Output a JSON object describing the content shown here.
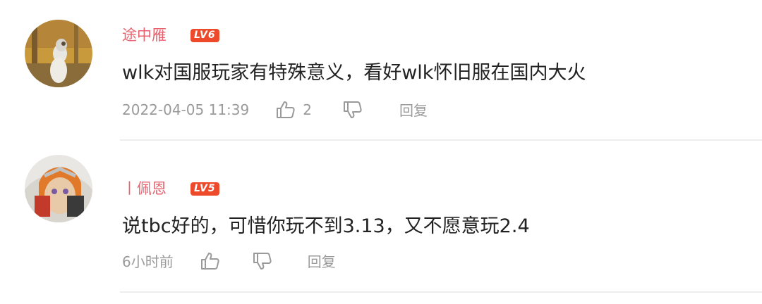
{
  "comments": [
    {
      "username": "途中雁",
      "level": "LV6",
      "content": "wlk对国服玩家有特殊意义，看好wlk怀旧服在国内大火",
      "time": "2022-04-05 11:39",
      "likes": "2",
      "reply_label": "回复",
      "avatar_icon": "dog-photo-avatar"
    },
    {
      "username": "丨佩恩",
      "level": "LV5",
      "content": "说tbc好的，可惜你玩不到3.13，又不愿意玩2.4",
      "time": "6小时前",
      "likes": "",
      "reply_label": "回复",
      "avatar_icon": "anime-character-avatar"
    }
  ],
  "colors": {
    "username": "#e8636f",
    "level_badge": "#ec4a2b",
    "meta": "#9a9a9a",
    "content": "#222222"
  }
}
